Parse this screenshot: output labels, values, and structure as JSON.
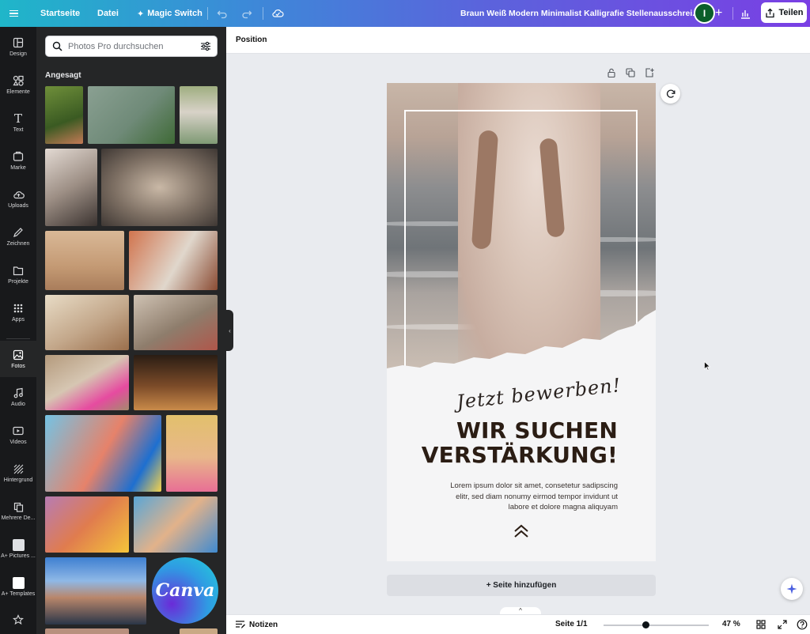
{
  "topbar": {
    "home_label": "Startseite",
    "file_label": "Datei",
    "magic_switch_label": "Magic Switch",
    "document_title": "Braun Weiß Modern Minimalist Kalligrafie Stellenausschrei...",
    "avatar_initial": "I",
    "share_label": "Teilen"
  },
  "rail": {
    "items": [
      {
        "label": "Design",
        "icon": "layout-icon"
      },
      {
        "label": "Elemente",
        "icon": "shapes-icon"
      },
      {
        "label": "Text",
        "icon": "text-icon"
      },
      {
        "label": "Marke",
        "icon": "brand-icon"
      },
      {
        "label": "Uploads",
        "icon": "cloud-upload-icon"
      },
      {
        "label": "Zeichnen",
        "icon": "pen-icon"
      },
      {
        "label": "Projekte",
        "icon": "folder-icon"
      },
      {
        "label": "Apps",
        "icon": "apps-grid-icon"
      },
      {
        "label": "Fotos",
        "icon": "image-icon"
      },
      {
        "label": "Audio",
        "icon": "music-icon"
      },
      {
        "label": "Videos",
        "icon": "video-icon"
      },
      {
        "label": "Hintergrund",
        "icon": "pattern-icon"
      },
      {
        "label": "Mehrere De...",
        "icon": "copy-icon"
      },
      {
        "label": "A+ Pictures ...",
        "icon": "app-icon"
      },
      {
        "label": "A+ Templates",
        "icon": "app-icon"
      }
    ],
    "active": "Fotos"
  },
  "panel": {
    "search_placeholder": "Photos Pro durchsuchen",
    "section_title": "Angesagt",
    "canva_logo_text": "Canva"
  },
  "context_bar": {
    "position_label": "Position"
  },
  "design": {
    "tagline": "Jetzt bewerben!",
    "headline_line1": "WIR SUCHEN",
    "headline_line2": "VERSTÄRKUNG!",
    "body_line1": "Lorem ipsum dolor sit amet, consetetur sadipscing",
    "body_line2": "elitr, sed diam nonumy eirmod tempor invidunt ut",
    "body_line3": "labore et dolore magna aliquyam"
  },
  "add_page_label": "+ Seite hinzufügen",
  "bottombar": {
    "notes_label": "Notizen",
    "page_count": "Seite 1/1",
    "zoom_value": "47 %",
    "zoom_fraction": 0.47
  },
  "colors": {
    "accent_gradient_start": "#1fb6c9",
    "accent_gradient_end": "#7a3fe4",
    "headline": "#2b1d14",
    "panel_bg": "#252627",
    "rail_bg": "#18191b"
  }
}
